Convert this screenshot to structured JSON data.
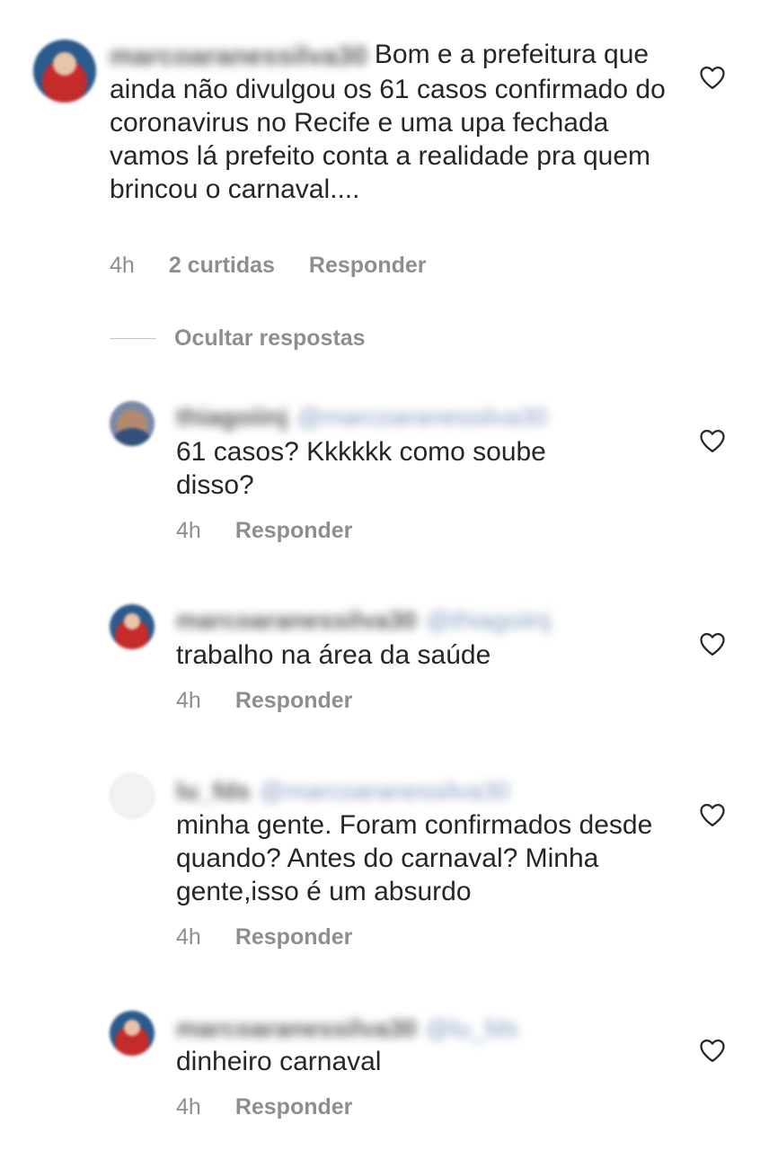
{
  "comments": [
    {
      "username": "marcoaranessilva30",
      "mention": "",
      "text": "Bom e a prefeitura que ainda não divulgou os 61 casos confirmado do coronavirus no Recife e uma upa fechada vamos lá prefeito conta a realidade pra quem brincou o carnaval....",
      "time": "4h",
      "likes": "2 curtidas",
      "reply": "Responder"
    }
  ],
  "hide_replies_label": "Ocultar respostas",
  "replies": [
    {
      "username": "thiagoiinj",
      "mention": "@marcoaranessilva30",
      "text": "61 casos? Kkkkkk como soube disso?",
      "time": "4h",
      "reply": "Responder"
    },
    {
      "username": "marcoaranessilva30",
      "mention": "@thiagoiinj",
      "text": "trabalho na área da saúde",
      "time": "4h",
      "reply": "Responder"
    },
    {
      "username": "lu_fds",
      "mention": "@marcoaranessilva30",
      "text": "minha gente. Foram confirmados desde quando? Antes do carnaval? Minha gente,isso é um absurdo",
      "time": "4h",
      "reply": "Responder"
    },
    {
      "username": "marcoaranessilva30",
      "mention": "@lu_fds",
      "text": "dinheiro carnaval",
      "time": "4h",
      "reply": "Responder"
    }
  ],
  "icons": {
    "like": "heart-outline-icon",
    "avatar": "user-avatar"
  },
  "colors": {
    "text": "#262626",
    "meta": "#8e8e8e",
    "mention": "#5b7aa8"
  }
}
